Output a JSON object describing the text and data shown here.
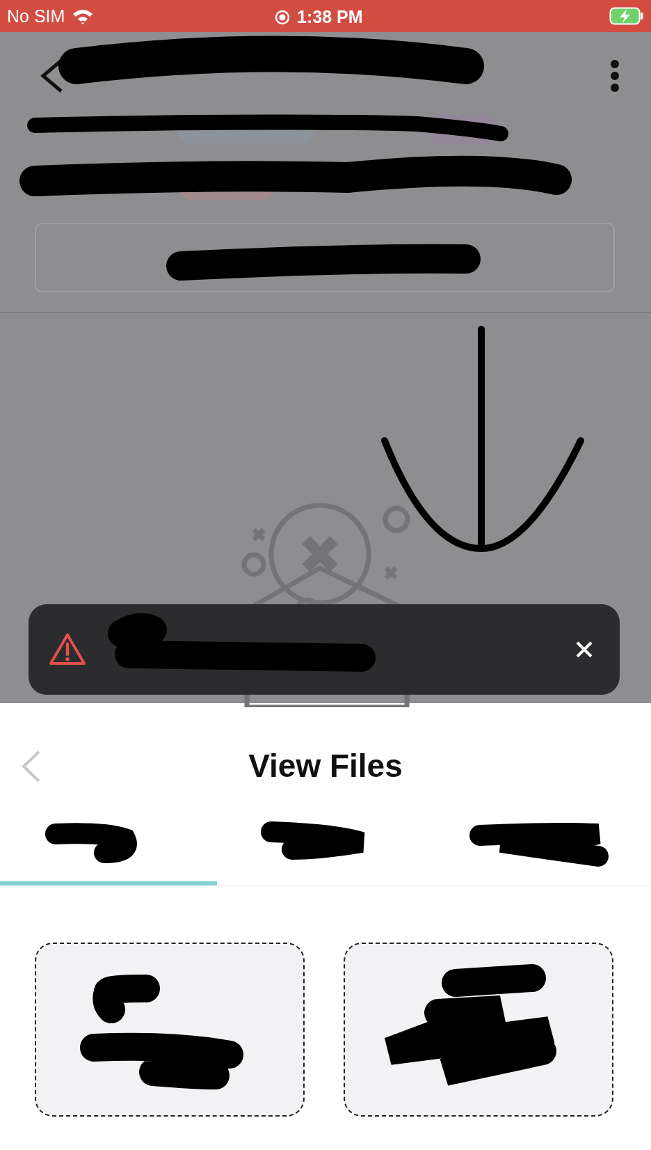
{
  "status_bar": {
    "carrier": "No SIM",
    "time": "1:38 PM",
    "charging": true
  },
  "sheet": {
    "title": "View Files",
    "tabs": [
      {
        "selected": true
      },
      {
        "selected": false
      },
      {
        "selected": false
      }
    ]
  }
}
